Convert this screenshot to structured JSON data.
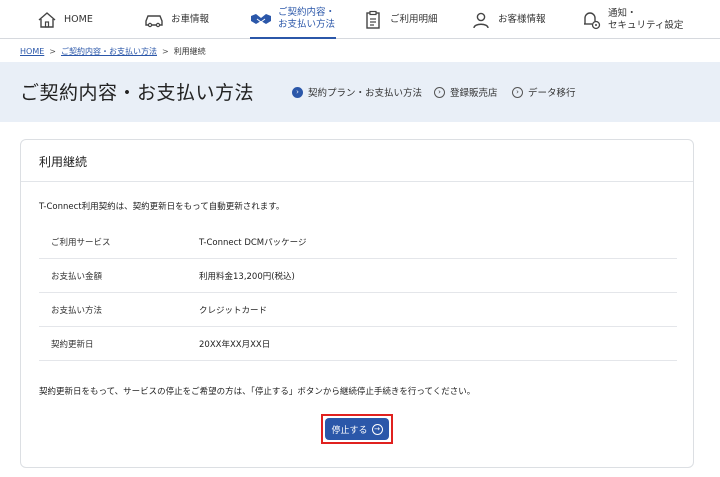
{
  "nav": {
    "home": "HOME",
    "car": "お車情報",
    "contract_line1": "ご契約内容・",
    "contract_line2": "お支払い方法",
    "statement": "ご利用明細",
    "customer": "お客様情報",
    "notify_line1": "通知・",
    "notify_line2": "セキュリティ設定"
  },
  "breadcrumb": {
    "home": "HOME",
    "contract": "ご契約内容・お支払い方法",
    "current": "利用継続",
    "sep": ">"
  },
  "header": {
    "title": "ご契約内容・お支払い方法",
    "tabs": [
      "契約プラン・お支払い方法",
      "登録販売店",
      "データ移行"
    ]
  },
  "card": {
    "title": "利用継続",
    "intro": "T-Connect利用契約は、契約更新日をもって自動更新されます。",
    "rows": [
      {
        "label": "ご利用サービス",
        "value": "T-Connect DCMパッケージ"
      },
      {
        "label": "お支払い金額",
        "value": "利用料金13,200円(税込)"
      },
      {
        "label": "お支払い方法",
        "value": "クレジットカード"
      },
      {
        "label": "契約更新日",
        "value": "20XX年XX月XX日"
      }
    ],
    "note": "契約更新日をもって、サービスの停止をご希望の方は、「停止する」ボタンから継続停止手続きを行ってください。",
    "button": "停止する"
  },
  "colors": {
    "accent": "#2b57a9",
    "band": "#e9eff7",
    "highlight": "#e0211f"
  }
}
